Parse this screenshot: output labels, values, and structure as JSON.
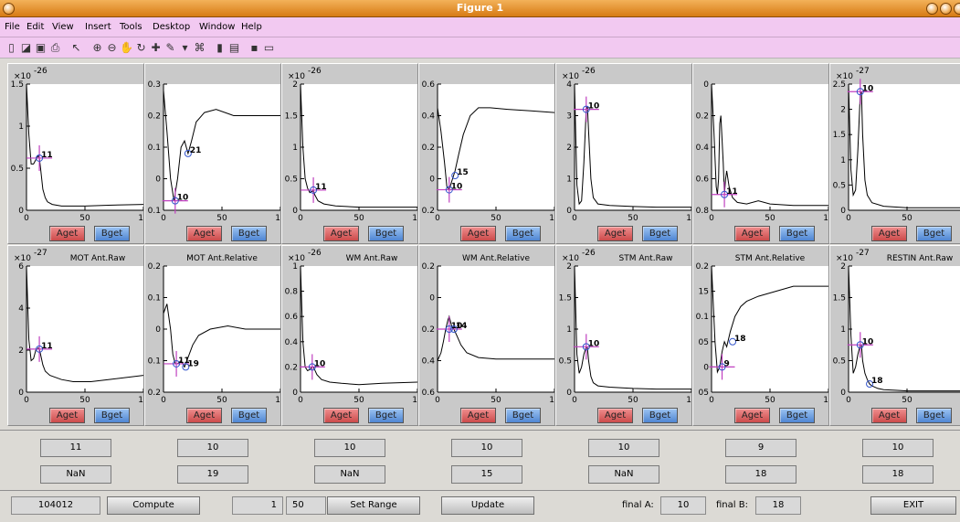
{
  "window": {
    "title": "Figure 1"
  },
  "menu": [
    "File",
    "Edit",
    "View",
    "Insert",
    "Tools",
    "Desktop",
    "Window",
    "Help"
  ],
  "toolbar_icons": [
    "new-figure-icon",
    "open-file-icon",
    "save-icon",
    "print-icon",
    "pointer-icon",
    "zoom-in-icon",
    "zoom-out-icon",
    "pan-icon",
    "rotate-icon",
    "data-cursor-icon",
    "brush-icon",
    "link-plot-icon",
    "colorbar-icon",
    "legend-icon",
    "hide-plot-tools-icon",
    "show-plot-tools-icon"
  ],
  "button_labels": {
    "a": "Aget",
    "b": "Bget"
  },
  "chart_data": [
    {
      "type": "line",
      "title": "",
      "exponent": "-26",
      "yticks": [
        "0",
        "0.5",
        "1",
        "1.5"
      ],
      "xticks": [
        "0",
        "50",
        "10"
      ],
      "ylim": [
        0,
        1.5
      ],
      "xlim": [
        0,
        100
      ],
      "series": [
        {
          "x": [
            0,
            2,
            4,
            6,
            8,
            10,
            11,
            12,
            14,
            16,
            18,
            22,
            30,
            50,
            70,
            100
          ],
          "y": [
            1.5,
            0.9,
            0.55,
            0.55,
            0.6,
            0.65,
            0.62,
            0.5,
            0.25,
            0.15,
            0.1,
            0.07,
            0.05,
            0.05,
            0.06,
            0.07
          ]
        }
      ],
      "markers": [
        {
          "x": 11,
          "y": 0.62,
          "label": "11",
          "cross": true
        }
      ]
    },
    {
      "type": "line",
      "title": "",
      "yticks": [
        "0.1",
        "0",
        "0.1",
        "0.2",
        "0.3"
      ],
      "xticks": [
        "0",
        "50",
        "10"
      ],
      "ylim": [
        -0.3,
        0.1
      ],
      "xlim": [
        0,
        100
      ],
      "series": [
        {
          "x": [
            0,
            3,
            6,
            9,
            12,
            15,
            18,
            21,
            24,
            28,
            35,
            45,
            60,
            80,
            100
          ],
          "y": [
            0.08,
            -0.05,
            -0.2,
            -0.27,
            -0.2,
            -0.1,
            -0.08,
            -0.12,
            -0.08,
            -0.02,
            0.01,
            0.02,
            0.0,
            0.0,
            0.0
          ]
        }
      ],
      "markers": [
        {
          "x": 10,
          "y": -0.27,
          "label": "10",
          "cross": true
        },
        {
          "x": 21,
          "y": -0.12,
          "label": "21",
          "cross": false
        }
      ]
    },
    {
      "type": "line",
      "title": "",
      "exponent": "-26",
      "yticks": [
        "0",
        "0.5",
        "1",
        "1.5",
        "2"
      ],
      "xticks": [
        "0",
        "50",
        "10"
      ],
      "ylim": [
        0,
        2
      ],
      "xlim": [
        0,
        100
      ],
      "series": [
        {
          "x": [
            0,
            2,
            4,
            6,
            8,
            10,
            11,
            12,
            15,
            20,
            30,
            50,
            70,
            100
          ],
          "y": [
            2,
            1.0,
            0.5,
            0.35,
            0.28,
            0.3,
            0.32,
            0.25,
            0.15,
            0.1,
            0.07,
            0.05,
            0.05,
            0.05
          ]
        }
      ],
      "markers": [
        {
          "x": 11,
          "y": 0.32,
          "label": "11",
          "cross": true
        }
      ]
    },
    {
      "type": "line",
      "title": "",
      "yticks": [
        "0.2",
        "0",
        "0.2",
        "0.4",
        "0.6"
      ],
      "xticks": [
        "0",
        "50",
        "10"
      ],
      "ylim": [
        -0.6,
        0.2
      ],
      "xlim": [
        0,
        100
      ],
      "series": [
        {
          "x": [
            0,
            3,
            6,
            8,
            10,
            12,
            15,
            18,
            22,
            28,
            35,
            45,
            60,
            80,
            100
          ],
          "y": [
            0.05,
            -0.1,
            -0.3,
            -0.45,
            -0.47,
            -0.42,
            -0.35,
            -0.25,
            -0.12,
            0.0,
            0.05,
            0.05,
            0.04,
            0.03,
            0.02
          ]
        }
      ],
      "markers": [
        {
          "x": 10,
          "y": -0.47,
          "label": "10",
          "cross": true
        },
        {
          "x": 15,
          "y": -0.38,
          "label": "15",
          "cross": false
        }
      ]
    },
    {
      "type": "line",
      "title": "",
      "exponent": "-26",
      "yticks": [
        "0",
        "1",
        "2",
        "3",
        "4"
      ],
      "xticks": [
        "0",
        "50",
        "10"
      ],
      "ylim": [
        0,
        4
      ],
      "xlim": [
        0,
        100
      ],
      "series": [
        {
          "x": [
            0,
            2,
            4,
            6,
            8,
            10,
            11,
            12,
            14,
            16,
            20,
            30,
            50,
            70,
            100
          ],
          "y": [
            4,
            0.8,
            0.2,
            0.3,
            1.5,
            3.2,
            3.3,
            2.5,
            1.0,
            0.4,
            0.2,
            0.15,
            0.12,
            0.1,
            0.1
          ]
        }
      ],
      "markers": [
        {
          "x": 10,
          "y": 3.2,
          "label": "10",
          "cross": true
        }
      ]
    },
    {
      "type": "line",
      "title": "",
      "yticks": [
        "0.8",
        "0.6",
        "0.4",
        "0.2",
        "0"
      ],
      "xticks": [
        "0",
        "50",
        "10"
      ],
      "ylim": [
        0,
        0.8
      ],
      "xlim": [
        0,
        100
      ],
      "series": [
        {
          "x": [
            0,
            2,
            4,
            5,
            6,
            7,
            8,
            10,
            11,
            12,
            13,
            15,
            18,
            22,
            30,
            40,
            50,
            70,
            100
          ],
          "y": [
            0.8,
            0.5,
            0.15,
            0.1,
            0.2,
            0.55,
            0.6,
            0.3,
            0.1,
            0.2,
            0.25,
            0.15,
            0.08,
            0.05,
            0.04,
            0.06,
            0.04,
            0.03,
            0.03
          ]
        }
      ],
      "markers": [
        {
          "x": 11,
          "y": 0.1,
          "label": "11",
          "cross": true
        }
      ]
    },
    {
      "type": "line",
      "title": "",
      "exponent": "-27",
      "yticks": [
        "0",
        "0.5",
        "1",
        "1.5",
        "2",
        "2.5"
      ],
      "xticks": [
        "0",
        "50",
        "1"
      ],
      "ylim": [
        0,
        2.5
      ],
      "xlim": [
        0,
        100
      ],
      "series": [
        {
          "x": [
            0,
            2,
            4,
            6,
            8,
            10,
            11,
            12,
            14,
            16,
            20,
            30,
            50,
            70,
            100
          ],
          "y": [
            2.5,
            0.8,
            0.3,
            0.4,
            1.2,
            2.3,
            2.35,
            1.5,
            0.6,
            0.3,
            0.15,
            0.08,
            0.05,
            0.05,
            0.05
          ]
        }
      ],
      "markers": [
        {
          "x": 10,
          "y": 2.35,
          "label": "10",
          "cross": true
        }
      ]
    },
    {
      "type": "line",
      "title": "MOT Ant.Raw",
      "exponent": "-27",
      "yticks": [
        "0",
        "2",
        "4",
        "6"
      ],
      "xticks": [
        "0",
        "50",
        "10"
      ],
      "ylim": [
        0,
        6
      ],
      "xlim": [
        0,
        100
      ],
      "series": [
        {
          "x": [
            0,
            2,
            4,
            6,
            8,
            10,
            11,
            12,
            14,
            16,
            20,
            30,
            40,
            55,
            70,
            100
          ],
          "y": [
            6,
            2.5,
            1.5,
            1.6,
            2.0,
            2.1,
            2.05,
            1.8,
            1.3,
            1.0,
            0.8,
            0.6,
            0.5,
            0.5,
            0.6,
            0.8
          ]
        }
      ],
      "markers": [
        {
          "x": 11,
          "y": 2.05,
          "label": "11",
          "cross": true
        }
      ]
    },
    {
      "type": "line",
      "title": "MOT Ant.Relative",
      "yticks": [
        "0.2",
        "0.1",
        "0",
        "0.1",
        "0.2"
      ],
      "xticks": [
        "0",
        "50",
        "10"
      ],
      "ylim": [
        -0.2,
        0.2
      ],
      "xlim": [
        0,
        100
      ],
      "series": [
        {
          "x": [
            0,
            3,
            6,
            8,
            10,
            12,
            15,
            18,
            20,
            25,
            30,
            40,
            55,
            70,
            100
          ],
          "y": [
            0.05,
            0.08,
            0.0,
            -0.08,
            -0.11,
            -0.11,
            -0.1,
            -0.12,
            -0.1,
            -0.05,
            -0.02,
            0.0,
            0.01,
            0.0,
            0.0
          ]
        }
      ],
      "markers": [
        {
          "x": 11,
          "y": -0.11,
          "label": "11",
          "cross": true
        },
        {
          "x": 19,
          "y": -0.12,
          "label": "19",
          "cross": false
        }
      ]
    },
    {
      "type": "line",
      "title": "WM Ant.Raw",
      "exponent": "-26",
      "yticks": [
        "0",
        "0.2",
        "0.4",
        "0.6",
        "0.8",
        "1"
      ],
      "xticks": [
        "0",
        "50",
        "10"
      ],
      "ylim": [
        0,
        1
      ],
      "xlim": [
        0,
        100
      ],
      "series": [
        {
          "x": [
            0,
            2,
            4,
            6,
            8,
            10,
            11,
            12,
            14,
            18,
            25,
            35,
            50,
            70,
            100
          ],
          "y": [
            1,
            0.4,
            0.2,
            0.17,
            0.18,
            0.2,
            0.2,
            0.18,
            0.14,
            0.1,
            0.08,
            0.07,
            0.06,
            0.07,
            0.08
          ]
        }
      ],
      "markers": [
        {
          "x": 10,
          "y": 0.2,
          "label": "10",
          "cross": true
        }
      ]
    },
    {
      "type": "line",
      "title": "WM Ant.Relative",
      "yticks": [
        "0.6",
        "0.4",
        "0.2",
        "0",
        "0.2"
      ],
      "xticks": [
        "0",
        "50",
        "10"
      ],
      "ylim": [
        -0.2,
        0.6
      ],
      "xlim": [
        0,
        100
      ],
      "series": [
        {
          "x": [
            0,
            3,
            5,
            7,
            9,
            10,
            12,
            14,
            17,
            20,
            25,
            35,
            50,
            70,
            100
          ],
          "y": [
            0.0,
            0.05,
            0.12,
            0.2,
            0.26,
            0.28,
            0.22,
            0.2,
            0.15,
            0.1,
            0.05,
            0.02,
            0.01,
            0.01,
            0.01
          ]
        }
      ],
      "markers": [
        {
          "x": 10,
          "y": 0.2,
          "label": "10",
          "cross": true
        },
        {
          "x": 14,
          "y": 0.2,
          "label": "14",
          "cross": false
        }
      ]
    },
    {
      "type": "line",
      "title": "STM Ant.Raw",
      "exponent": "-26",
      "yticks": [
        "0",
        "0.5",
        "1",
        "1.5",
        "2"
      ],
      "xticks": [
        "0",
        "50",
        "10"
      ],
      "ylim": [
        0,
        2
      ],
      "xlim": [
        0,
        100
      ],
      "series": [
        {
          "x": [
            0,
            2,
            4,
            6,
            8,
            10,
            11,
            12,
            14,
            16,
            20,
            30,
            50,
            70,
            100
          ],
          "y": [
            2,
            0.6,
            0.3,
            0.4,
            0.6,
            0.72,
            0.7,
            0.5,
            0.25,
            0.15,
            0.1,
            0.08,
            0.06,
            0.05,
            0.05
          ]
        }
      ],
      "markers": [
        {
          "x": 10,
          "y": 0.72,
          "label": "10",
          "cross": true
        }
      ]
    },
    {
      "type": "line",
      "title": "STM Ant.Relative",
      "yticks": [
        "05",
        "0",
        "05",
        "0.1",
        "15",
        "0.2"
      ],
      "xticks": [
        "0",
        "50",
        "10"
      ],
      "ylim": [
        -0.2,
        0.05
      ],
      "xlim": [
        0,
        100
      ],
      "series": [
        {
          "x": [
            0,
            3,
            5,
            7,
            9,
            11,
            13,
            16,
            20,
            25,
            30,
            40,
            55,
            70,
            85,
            100
          ],
          "y": [
            0.05,
            -0.1,
            -0.16,
            -0.15,
            -0.12,
            -0.1,
            -0.11,
            -0.08,
            -0.05,
            -0.03,
            -0.02,
            -0.01,
            0.0,
            0.01,
            0.01,
            0.01
          ]
        }
      ],
      "markers": [
        {
          "x": 9,
          "y": -0.15,
          "label": "9",
          "cross": true
        },
        {
          "x": 18,
          "y": -0.1,
          "label": "18",
          "cross": false
        }
      ]
    },
    {
      "type": "line",
      "title": "RESTIN Ant.Raw",
      "exponent": "-27",
      "yticks": [
        "0",
        "0.5",
        "1",
        "1.5",
        "2"
      ],
      "xticks": [
        "0",
        "50",
        "1"
      ],
      "ylim": [
        0,
        2
      ],
      "xlim": [
        0,
        100
      ],
      "series": [
        {
          "x": [
            0,
            2,
            4,
            6,
            8,
            10,
            11,
            12,
            14,
            16,
            18,
            20,
            25,
            30,
            40,
            50,
            60,
            70,
            100
          ],
          "y": [
            2,
            0.9,
            0.3,
            0.4,
            0.6,
            0.75,
            0.75,
            0.5,
            0.3,
            0.2,
            0.13,
            0.1,
            0.06,
            0.04,
            0.03,
            0.02,
            0.02,
            0.02,
            0.02
          ]
        }
      ],
      "markers": [
        {
          "x": 10,
          "y": 0.75,
          "label": "10",
          "cross": true
        },
        {
          "x": 18,
          "y": 0.13,
          "label": "18",
          "cross": false
        }
      ]
    }
  ],
  "strip1": [
    "11",
    "10",
    "10",
    "10",
    "10",
    "9",
    "10"
  ],
  "strip2": [
    "NaN",
    "19",
    "NaN",
    "15",
    "NaN",
    "18",
    "18"
  ],
  "controls": {
    "subject": "104012",
    "compute_label": "Compute",
    "range_start": "1",
    "range_end": "50",
    "set_range_label": "Set Range",
    "update_label": "Update",
    "final_a_label": "final A:",
    "final_a_value": "10",
    "final_b_label": "final B:",
    "final_b_value": "18",
    "exit_label": "EXIT"
  }
}
